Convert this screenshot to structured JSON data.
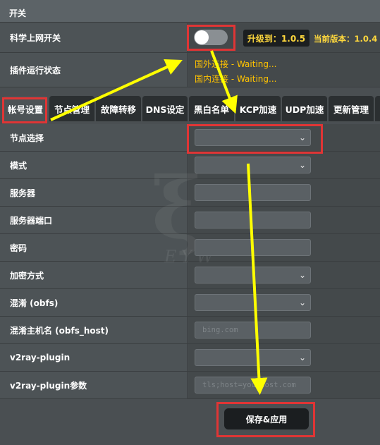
{
  "header": {
    "title": "开关"
  },
  "switch_row": {
    "label": "科学上网开关",
    "upgrade_button": "升级到：1.0.5",
    "current_version": "当前版本：1.0.4"
  },
  "status_row": {
    "label": "插件运行状态",
    "foreign": "国外连接 - Waiting...",
    "domestic": "国内连接 - Waiting..."
  },
  "tabs": [
    {
      "label": "帐号设置"
    },
    {
      "label": "节点管理"
    },
    {
      "label": "故障转移"
    },
    {
      "label": "DNS设定"
    },
    {
      "label": "黑白名单"
    },
    {
      "label": "KCP加速"
    },
    {
      "label": "UDP加速"
    },
    {
      "label": "更新管理"
    }
  ],
  "fields": {
    "node_select": {
      "label": "节点选择",
      "value": ""
    },
    "mode": {
      "label": "模式",
      "value": ""
    },
    "server": {
      "label": "服务器",
      "value": ""
    },
    "server_port": {
      "label": "服务器端口",
      "value": ""
    },
    "password": {
      "label": "密码",
      "value": ""
    },
    "encryption": {
      "label": "加密方式",
      "value": ""
    },
    "obfs": {
      "label": "混淆 (obfs)",
      "value": ""
    },
    "obfs_host": {
      "label": "混淆主机名 (obfs_host)",
      "placeholder": "bing.com"
    },
    "v2ray_plugin": {
      "label": "v2ray-plugin",
      "value": ""
    },
    "v2ray_plugin_params": {
      "label": "v2ray-plugin参数",
      "placeholder": "tls;host=yourhost.com"
    }
  },
  "save_button": "保存&应用",
  "colors": {
    "accent_yellow": "#ffd83d",
    "status_orange": "#ffc300",
    "highlight_red": "#e03535",
    "arrow_yellow": "#ffff00"
  }
}
